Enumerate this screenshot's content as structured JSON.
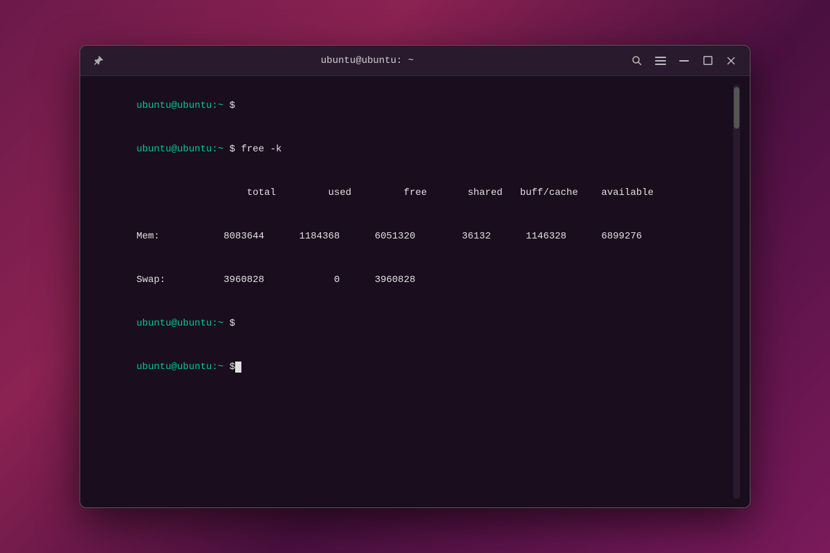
{
  "titlebar": {
    "title": "ubuntu@ubuntu: ~",
    "pin_icon": "📌",
    "search_icon": "🔍",
    "menu_icon": "☰",
    "minimize_icon": "–",
    "maximize_icon": "□",
    "close_icon": "✕"
  },
  "terminal": {
    "prompt_user": "ubuntu@ubuntu:",
    "prompt_sep": "~",
    "line1_cmd": " free -k",
    "headers": {
      "total": "total",
      "used": "used",
      "free": "free",
      "shared": "shared",
      "buff_cache": "buff/cache",
      "available": "available"
    },
    "mem_row": {
      "label": "Mem:",
      "total": "8083644",
      "used": "1184368",
      "free": "6051320",
      "shared": "36132",
      "buff_cache": "1146328",
      "available": "6899276"
    },
    "swap_row": {
      "label": "Swap:",
      "total": "3960828",
      "used": "0",
      "free": "3960828"
    }
  }
}
